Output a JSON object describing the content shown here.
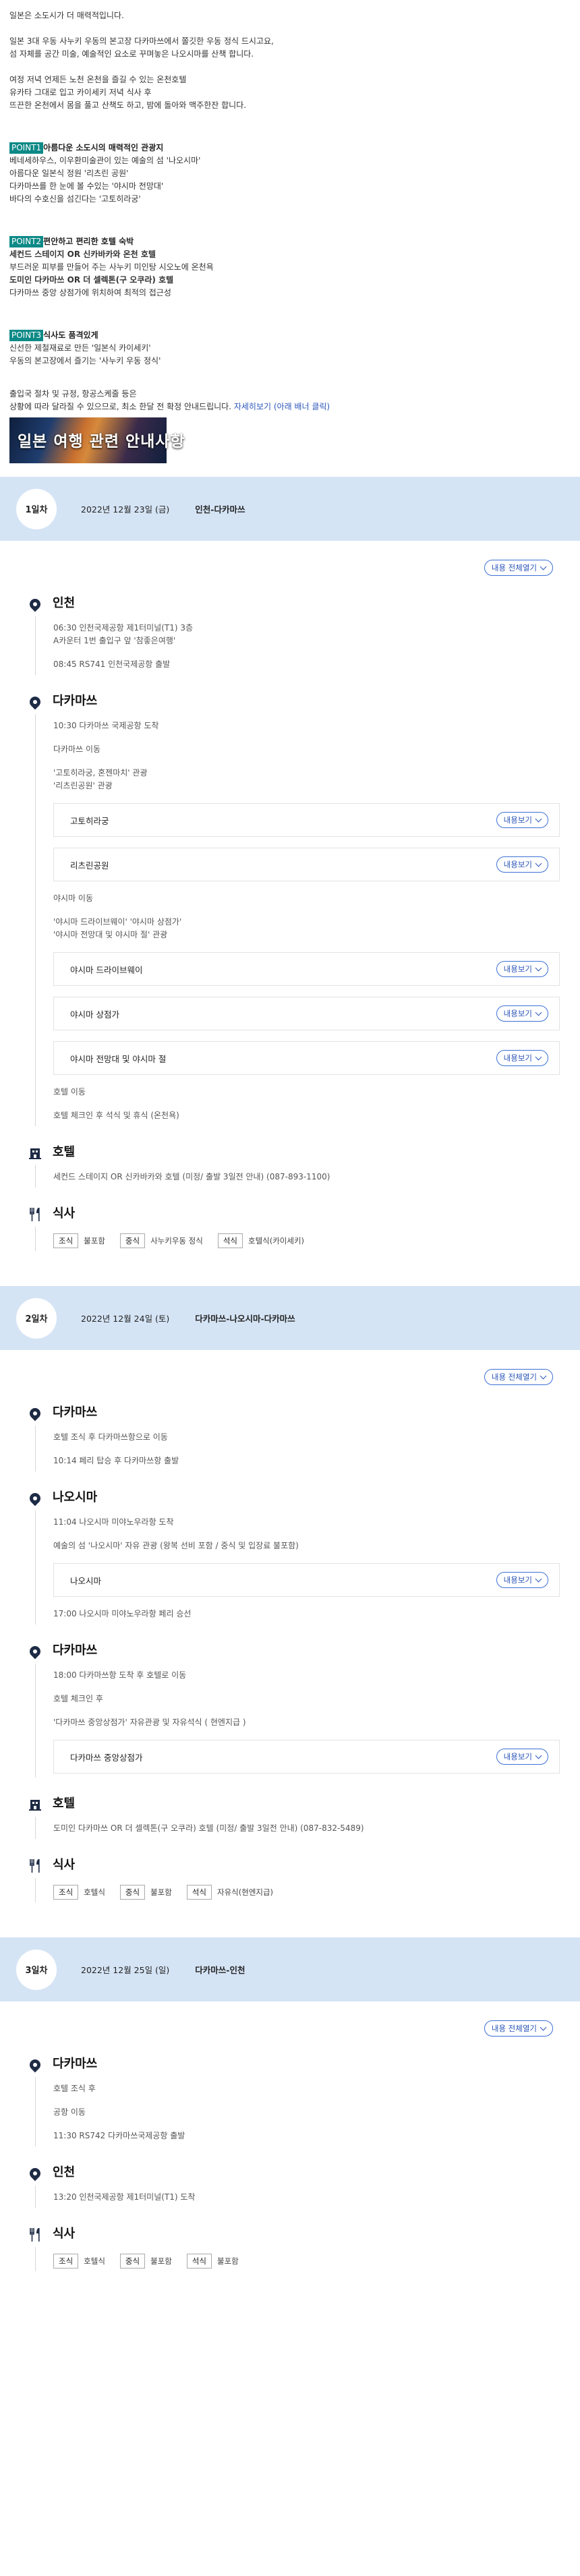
{
  "intro": {
    "line1": "일본은 소도시가 더 매력적입니다.",
    "p2a": "일본 3대 우동 사누키 우동의 본고장 다카마쓰에서 쫄깃한 우동 정식 드시고요,",
    "p2b": "섬 자체를 공간 미술, 예술적인 요소로 꾸며놓은 나오시마를 산책 합니다.",
    "p3a": "여정 저녁 언제든 노천 온천을 즐길 수 있는 온천호텔",
    "p3b": "유카타 그대로 입고 카이세키 저녁 식사 후",
    "p3c": "뜨끈한 온천에서 몸을 풀고 산책도 하고, 밤에 돌아와 맥주한잔 합니다.",
    "points": [
      {
        "tag": "POINT1",
        "title": "아름다운 소도시의 매력적인 관광지",
        "lines": [
          "베네세하우스, 이우환미술관이 있는 예술의 섬 '나오시마'",
          "아름다운 일본식 정원 '리츠린 공원'",
          "다카마쓰를 한 눈에 볼 수있는 '야시마 전망대'",
          "바다의 수호신을 섬긴다는 '고토히라궁'"
        ]
      },
      {
        "tag": "POINT2",
        "title": "편안하고 편리한 호텔 숙박",
        "lines": [
          "세컨드 스테이지 OR 신카바카와 온천 호텔",
          "부드러운 피부를 만들어 주는 사누키 미인탕 시오노에 온천욕",
          "도미인 다카마쓰 OR 더 셀렉톤(구 오쿠라) 호텔",
          "다카마쓰 중앙 상점가에 위치하여 최적의 접근성"
        ]
      },
      {
        "tag": "POINT3",
        "title": "식사도 품격있게",
        "lines": [
          "신선한 제철재료로 만든 '일본식 카이세키'",
          "우동의 본고장에서 즐기는 '사누키 우동 정식'"
        ]
      }
    ],
    "notice1": "출입국 절차 및 규정, 항공스케줄 등은",
    "notice2": "상황에 따라 달라질 수 있으므로, 최소 한달 전 확정 안내드립니다.",
    "notice_link": "자세히보기 (아래 배너 클릭)",
    "banner": "일본 여행 관련 안내사항"
  },
  "labels": {
    "toggle_all": "내용 전체열기",
    "detail": "내용보기"
  },
  "days": [
    {
      "badge": "1일차",
      "date": "2022년 12월 23일 (금)",
      "route": "인천-다카마쓰",
      "sections": [
        {
          "type": "place",
          "title": "인천",
          "items": [
            {
              "t": "text",
              "v": "06:30 인천국제공항 제1터미널(T1) 3층"
            },
            {
              "t": "text",
              "v": "A카운터 1번 출입구 앞 '참좋은여행'"
            },
            {
              "t": "sp"
            },
            {
              "t": "text",
              "v": "08:45 RS741 인천국제공항 출발"
            }
          ]
        },
        {
          "type": "place",
          "title": "다카마쓰",
          "items": [
            {
              "t": "text",
              "v": "10:30 다카마쓰 국제공항 도착"
            },
            {
              "t": "sp"
            },
            {
              "t": "text",
              "v": "다카마쓰 이동"
            },
            {
              "t": "sp"
            },
            {
              "t": "text",
              "v": "'고토히라궁, 혼젠마치' 관광"
            },
            {
              "t": "text",
              "v": "'리츠린공원' 관광"
            },
            {
              "t": "sp"
            },
            {
              "t": "box",
              "v": "고토히라궁"
            },
            {
              "t": "sp"
            },
            {
              "t": "box",
              "v": "리츠린공원"
            },
            {
              "t": "sp"
            },
            {
              "t": "text",
              "v": "야시마 이동"
            },
            {
              "t": "sp"
            },
            {
              "t": "text",
              "v": "'야시마 드라이브웨이' '야시마 상점가'"
            },
            {
              "t": "text",
              "v": "'야시마 전망대 및 야시마 절' 관광"
            },
            {
              "t": "sp"
            },
            {
              "t": "box",
              "v": "야시마 드라이브웨이"
            },
            {
              "t": "sp"
            },
            {
              "t": "box",
              "v": "야시마 상점가"
            },
            {
              "t": "sp"
            },
            {
              "t": "box",
              "v": "야시마 전망대 및 야시마 절"
            },
            {
              "t": "sp"
            },
            {
              "t": "text",
              "v": "호텔 이동"
            },
            {
              "t": "sp"
            },
            {
              "t": "text",
              "v": "호텔 체크인 후 석식 및 휴식 (온천욕)"
            }
          ]
        },
        {
          "type": "hotel",
          "title": "호텔",
          "items": [
            {
              "t": "text",
              "v": "세컨드 스테이지 OR 신카바카와 호텔 (미정/ 출발 3일전 안내) (087-893-1100)"
            }
          ]
        },
        {
          "type": "meal",
          "title": "식사",
          "meals": [
            [
              "조식",
              "불포함"
            ],
            [
              "중식",
              "사누키우동 정식"
            ],
            [
              "석식",
              "호텔식(카이세키)"
            ]
          ]
        }
      ]
    },
    {
      "badge": "2일차",
      "date": "2022년 12월 24일 (토)",
      "route": "다카마쓰-나오시마-다카마쓰",
      "sections": [
        {
          "type": "place",
          "title": "다카마쓰",
          "items": [
            {
              "t": "text",
              "v": "호텔 조식 후 다카마쓰항으로 이동"
            },
            {
              "t": "sp"
            },
            {
              "t": "text",
              "v": "10:14 페리 탑승 후 다카마쓰항 출발"
            }
          ]
        },
        {
          "type": "place",
          "title": "나오시마",
          "items": [
            {
              "t": "text",
              "v": "11:04 나오시마 미야노우라항 도착"
            },
            {
              "t": "sp"
            },
            {
              "t": "text",
              "v": "예술의 섬 '나오시마' 자유 관광 (왕복 선비 포함 / 중식 및 입장료 불포함)"
            },
            {
              "t": "sp"
            },
            {
              "t": "box",
              "v": "나오시마"
            },
            {
              "t": "sp"
            },
            {
              "t": "text",
              "v": "17:00 나오시마 미야노우라항 페리 승선"
            }
          ]
        },
        {
          "type": "place",
          "title": "다카마쓰",
          "items": [
            {
              "t": "text",
              "v": "18:00 다카마쓰항 도착 후 호텔로 이동"
            },
            {
              "t": "sp"
            },
            {
              "t": "text",
              "v": "호텔 체크인 후"
            },
            {
              "t": "sp"
            },
            {
              "t": "text",
              "v": "'다카마쓰 중앙상점가' 자유관광 및 자유석식 ( 현엔지급 )"
            },
            {
              "t": "sp"
            },
            {
              "t": "box",
              "v": "다카마쓰 중앙상점가"
            }
          ]
        },
        {
          "type": "hotel",
          "title": "호텔",
          "items": [
            {
              "t": "text",
              "v": "도미인 다카마쓰 OR 더 셀렉톤(구 오쿠라) 호텔 (미정/ 출발 3일전 안내) (087-832-5489)"
            }
          ]
        },
        {
          "type": "meal",
          "title": "식사",
          "meals": [
            [
              "조식",
              "호텔식"
            ],
            [
              "중식",
              "불포함"
            ],
            [
              "석식",
              "자유식(현엔지급)"
            ]
          ]
        }
      ]
    },
    {
      "badge": "3일차",
      "date": "2022년 12월 25일 (일)",
      "route": "다카마쓰-인천",
      "sections": [
        {
          "type": "place",
          "title": "다카마쓰",
          "items": [
            {
              "t": "text",
              "v": "호텔 조식 후"
            },
            {
              "t": "sp"
            },
            {
              "t": "text",
              "v": "공항 이동"
            },
            {
              "t": "sp"
            },
            {
              "t": "text",
              "v": "11:30 RS742 다카마쓰국제공항 출발"
            }
          ]
        },
        {
          "type": "place",
          "title": "인천",
          "items": [
            {
              "t": "text",
              "v": "13:20 인천국제공항 제1터미널(T1) 도착"
            }
          ]
        },
        {
          "type": "meal",
          "title": "식사",
          "meals": [
            [
              "조식",
              "호텔식"
            ],
            [
              "중식",
              "불포함"
            ],
            [
              "석식",
              "불포함"
            ]
          ]
        }
      ]
    }
  ]
}
